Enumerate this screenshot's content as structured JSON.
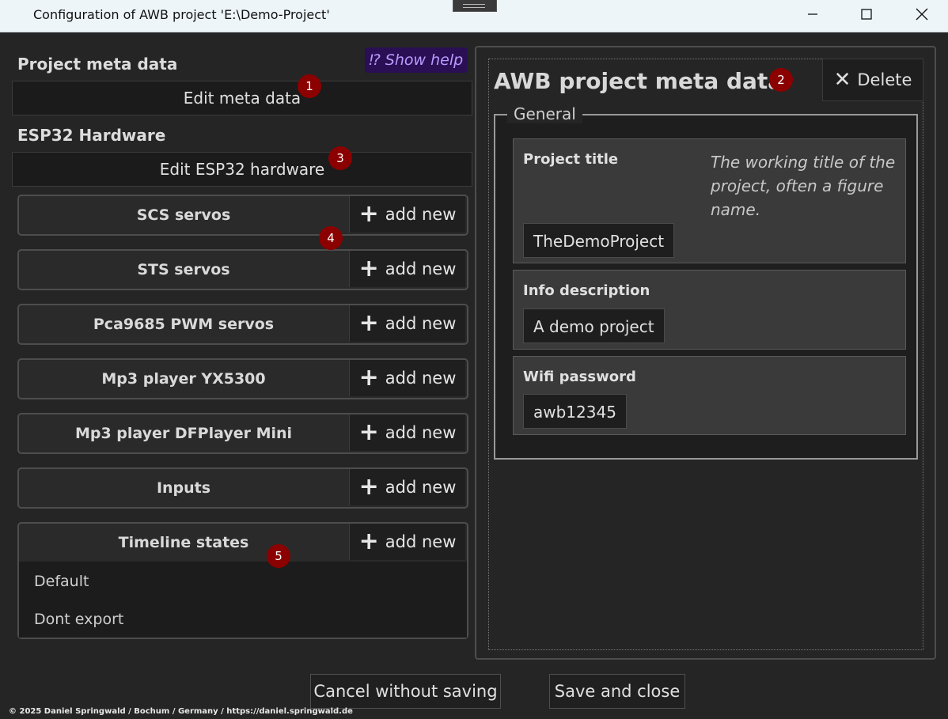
{
  "window": {
    "title": "Configuration of AWB project 'E:\\Demo-Project'"
  },
  "left": {
    "meta_title": "Project meta data",
    "show_help": "⁉ Show help",
    "edit_meta": "Edit meta data",
    "esp_title": "ESP32 Hardware",
    "edit_esp": "Edit ESP32 hardware",
    "add_new": "add new",
    "groups": [
      {
        "label": "SCS servos"
      },
      {
        "label": "STS servos"
      },
      {
        "label": "Pca9685 PWM servos"
      },
      {
        "label": "Mp3 player YX5300"
      },
      {
        "label": "Mp3 player DFPlayer Mini"
      },
      {
        "label": "Inputs"
      }
    ],
    "timeline": {
      "label": "Timeline states",
      "items": [
        "Default",
        "Dont export"
      ]
    }
  },
  "badges": [
    "1",
    "2",
    "3",
    "4",
    "5"
  ],
  "right": {
    "title": "AWB project meta data",
    "delete": "Delete",
    "legend": "General",
    "fields": [
      {
        "label": "Project title",
        "hint": "The working title of the project, often a figure name.",
        "value": "TheDemoProject"
      },
      {
        "label": "Info description",
        "value": "A demo project"
      },
      {
        "label": "Wifi password",
        "value": "awb12345"
      }
    ]
  },
  "bottom": {
    "cancel": "Cancel without saving",
    "save": "Save and close"
  },
  "footer": "© 2025 Daniel Springwald / Bochum / Germany / https://daniel.springwald.de",
  "colors": {
    "badge": "#8b0000",
    "help_bg": "#2a0f55",
    "help_text": "#b89cff",
    "background": "#252525"
  }
}
